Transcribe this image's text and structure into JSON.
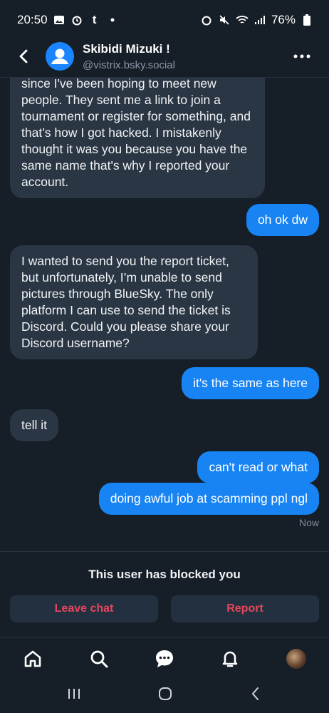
{
  "status_bar": {
    "time": "20:50",
    "battery": "76%"
  },
  "header": {
    "name": "Skibidi Mizuki !",
    "handle": "@vistrix.bsky.social"
  },
  "messages": [
    {
      "dir": "in",
      "text": "since I've been hoping to meet new people. They sent me a link to join a tournament or register for something, and that’s how I got hacked. I mistakenly thought it was you because you have the same name that's why I reported your account."
    },
    {
      "dir": "out",
      "text": "oh ok dw"
    },
    {
      "dir": "in",
      "text": "I wanted to send you the report ticket, but unfortunately, I’m unable to send pictures through BlueSky. The only platform I can use to send the ticket is Discord. Could you please share your Discord username?"
    },
    {
      "dir": "out",
      "text": "it's the same as here"
    },
    {
      "dir": "in",
      "text": "tell it"
    },
    {
      "dir": "out",
      "text": "can't read or what"
    },
    {
      "dir": "out",
      "text": "doing awful job at scamming ppl ngl"
    }
  ],
  "timestamp": "Now",
  "blocked": {
    "text": "This user has blocked you",
    "leave_label": "Leave chat",
    "report_label": "Report"
  },
  "colors": {
    "background": "#161e27",
    "incoming_bubble": "#2a3644",
    "outgoing_bubble": "#1884f4",
    "danger": "#e5455b"
  }
}
